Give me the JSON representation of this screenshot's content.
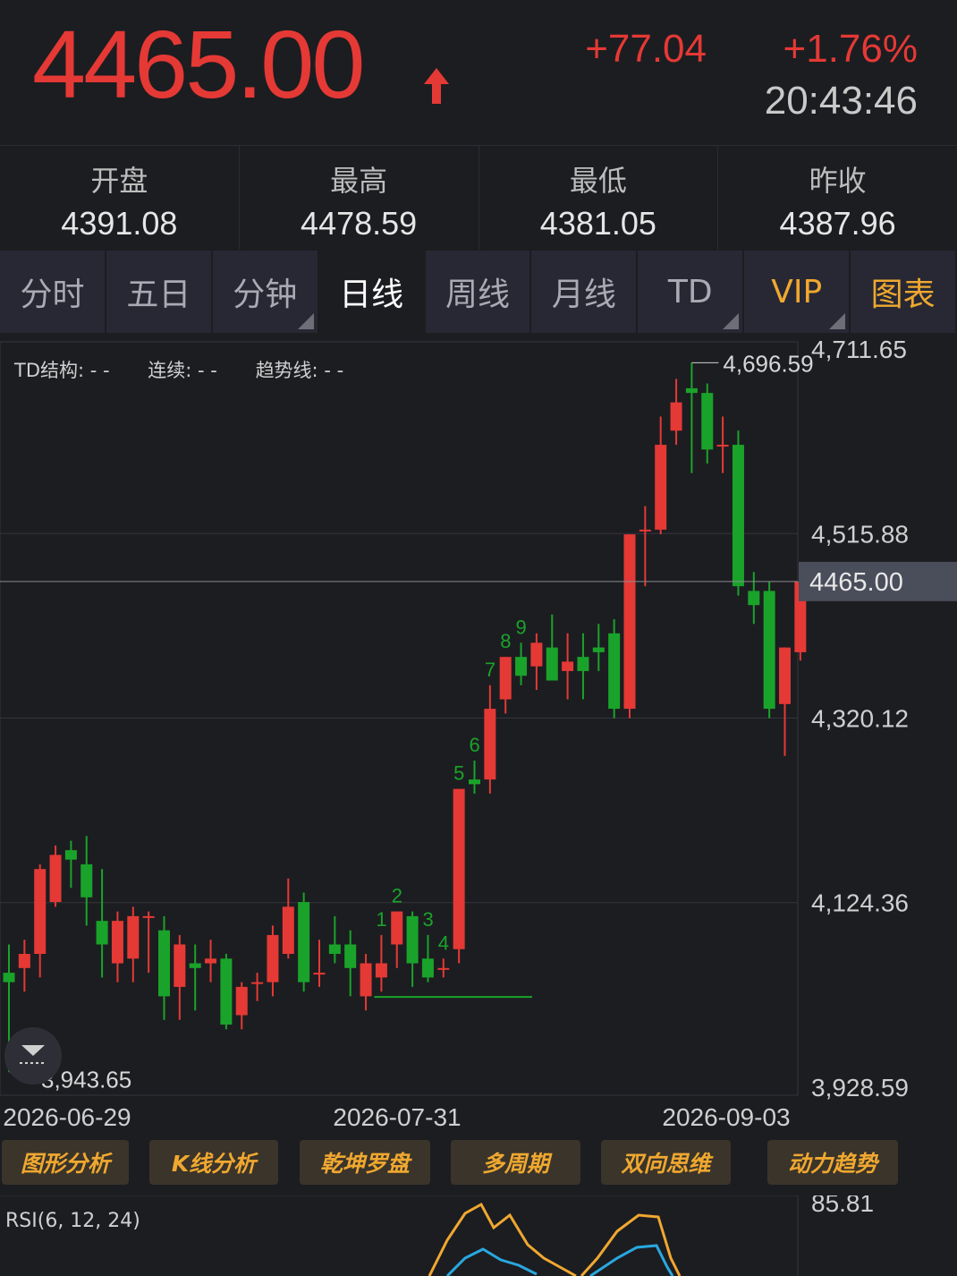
{
  "header": {
    "price": "4465.00",
    "change": "+77.04",
    "change_pct": "+1.76%",
    "time": "20:43:46",
    "up_color": "#e53935",
    "down_color": "#1aa32a"
  },
  "stats": [
    {
      "label": "开盘",
      "value": "4391.08"
    },
    {
      "label": "最高",
      "value": "4478.59"
    },
    {
      "label": "最低",
      "value": "4381.05"
    },
    {
      "label": "昨收",
      "value": "4387.96"
    }
  ],
  "tabs": [
    "分时",
    "五日",
    "分钟",
    "日线",
    "周线",
    "月线",
    "TD",
    "VIP",
    "图表"
  ],
  "legend": {
    "td": "TD结构: - -",
    "cont": "连续: - -",
    "trend": "趋势线: - -"
  },
  "chart_data": {
    "type": "candlestick",
    "y_ticks": [
      "4,711.65",
      "4,515.88",
      "4,320.12",
      "4,124.36",
      "3,928.59"
    ],
    "y_tick_values": [
      4711.65,
      4515.88,
      4320.12,
      4124.36,
      3928.59
    ],
    "x_ticks": [
      "2026-06-29",
      "2026-07-31",
      "2026-09-03"
    ],
    "current_price_label": "4465.00",
    "current_price": 4465.0,
    "high_label": "4,696.59",
    "low_label": "3,943.65",
    "td_labels": [
      "1",
      "2",
      "3",
      "4",
      "5",
      "6",
      "7",
      "8",
      "9"
    ],
    "candles": [
      {
        "o": 4050,
        "h": 4080,
        "l": 3945,
        "c": 4040
      },
      {
        "o": 4055,
        "h": 4085,
        "l": 4030,
        "c": 4070
      },
      {
        "o": 4070,
        "h": 4165,
        "l": 4045,
        "c": 4160
      },
      {
        "o": 4125,
        "h": 4185,
        "l": 4120,
        "c": 4175
      },
      {
        "o": 4180,
        "h": 4190,
        "l": 4140,
        "c": 4170
      },
      {
        "o": 4165,
        "h": 4195,
        "l": 4100,
        "c": 4130
      },
      {
        "o": 4105,
        "h": 4160,
        "l": 4045,
        "c": 4080
      },
      {
        "o": 4060,
        "h": 4115,
        "l": 4040,
        "c": 4105
      },
      {
        "o": 4065,
        "h": 4120,
        "l": 4040,
        "c": 4110
      },
      {
        "o": 4110,
        "h": 4115,
        "l": 4050,
        "c": 4110
      },
      {
        "o": 4095,
        "h": 4110,
        "l": 4000,
        "c": 4025
      },
      {
        "o": 4035,
        "h": 4090,
        "l": 4000,
        "c": 4080
      },
      {
        "o": 4060,
        "h": 4080,
        "l": 4010,
        "c": 4055
      },
      {
        "o": 4060,
        "h": 4085,
        "l": 4040,
        "c": 4065
      },
      {
        "o": 4065,
        "h": 4070,
        "l": 3990,
        "c": 3995
      },
      {
        "o": 4005,
        "h": 4040,
        "l": 3990,
        "c": 4035
      },
      {
        "o": 4040,
        "h": 4050,
        "l": 4020,
        "c": 4040
      },
      {
        "o": 4040,
        "h": 4100,
        "l": 4025,
        "c": 4090
      },
      {
        "o": 4070,
        "h": 4150,
        "l": 4065,
        "c": 4120
      },
      {
        "o": 4125,
        "h": 4135,
        "l": 4030,
        "c": 4040
      },
      {
        "o": 4050,
        "h": 4085,
        "l": 4035,
        "c": 4050
      },
      {
        "o": 4080,
        "h": 4110,
        "l": 4060,
        "c": 4070
      },
      {
        "o": 4080,
        "h": 4095,
        "l": 4025,
        "c": 4055
      },
      {
        "o": 4025,
        "h": 4070,
        "l": 4010,
        "c": 4060
      },
      {
        "o": 4045,
        "h": 4090,
        "l": 4030,
        "c": 4060
      },
      {
        "o": 4080,
        "h": 4115,
        "l": 4055,
        "c": 4115
      },
      {
        "o": 4110,
        "h": 4115,
        "l": 4035,
        "c": 4060
      },
      {
        "o": 4065,
        "h": 4090,
        "l": 4040,
        "c": 4045
      },
      {
        "o": 4055,
        "h": 4065,
        "l": 4045,
        "c": 4055
      },
      {
        "o": 4075,
        "h": 4245,
        "l": 4060,
        "c": 4245
      },
      {
        "o": 4255,
        "h": 4275,
        "l": 4240,
        "c": 4250
      },
      {
        "o": 4255,
        "h": 4355,
        "l": 4240,
        "c": 4330
      },
      {
        "o": 4340,
        "h": 4385,
        "l": 4325,
        "c": 4385
      },
      {
        "o": 4385,
        "h": 4400,
        "l": 4355,
        "c": 4365
      },
      {
        "o": 4375,
        "h": 4410,
        "l": 4350,
        "c": 4400
      },
      {
        "o": 4395,
        "h": 4430,
        "l": 4360,
        "c": 4360
      },
      {
        "o": 4370,
        "h": 4410,
        "l": 4340,
        "c": 4380
      },
      {
        "o": 4385,
        "h": 4410,
        "l": 4340,
        "c": 4370
      },
      {
        "o": 4395,
        "h": 4420,
        "l": 4370,
        "c": 4390
      },
      {
        "o": 4410,
        "h": 4425,
        "l": 4320,
        "c": 4330
      },
      {
        "o": 4330,
        "h": 4515,
        "l": 4320,
        "c": 4515
      },
      {
        "o": 4520,
        "h": 4545,
        "l": 4460,
        "c": 4520
      },
      {
        "o": 4520,
        "h": 4640,
        "l": 4515,
        "c": 4610
      },
      {
        "o": 4625,
        "h": 4680,
        "l": 4610,
        "c": 4655
      },
      {
        "o": 4670,
        "h": 4697,
        "l": 4580,
        "c": 4665
      },
      {
        "o": 4665,
        "h": 4675,
        "l": 4590,
        "c": 4605
      },
      {
        "o": 4610,
        "h": 4640,
        "l": 4580,
        "c": 4610
      },
      {
        "o": 4610,
        "h": 4625,
        "l": 4450,
        "c": 4460
      },
      {
        "o": 4455,
        "h": 4475,
        "l": 4420,
        "c": 4440
      },
      {
        "o": 4455,
        "h": 4465,
        "l": 4320,
        "c": 4330
      },
      {
        "o": 4335,
        "h": 4395,
        "l": 4280,
        "c": 4395
      },
      {
        "o": 4390,
        "h": 4478.59,
        "l": 4381.05,
        "c": 4465
      }
    ]
  },
  "indicator_buttons": [
    "图形分析",
    "K线分析",
    "乾坤罗盘",
    "多周期",
    "双向思维",
    "动力趋势"
  ],
  "rsi": {
    "label": "RSI(6, 12, 24)",
    "top_value": "85.81",
    "colors": [
      "#f0a830",
      "#29a8e0"
    ]
  }
}
